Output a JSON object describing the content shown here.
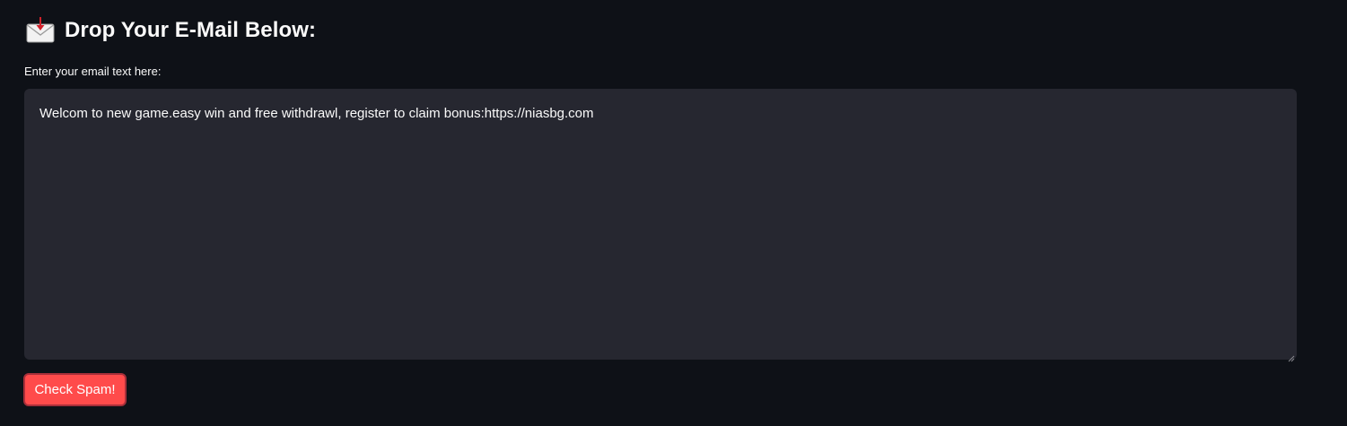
{
  "header": {
    "icon": "incoming-envelope-icon",
    "title": "Drop Your E-Mail Below:"
  },
  "email_field": {
    "label": "Enter your email text here:",
    "value": "Welcom to new game.easy win and free withdrawl, register to claim bonus:https://niasbg.com"
  },
  "actions": {
    "check_label": "Check Spam!"
  },
  "colors": {
    "background": "#0e1117",
    "input_background": "#262730",
    "accent": "#ff4b4b",
    "text": "#fafafa"
  }
}
